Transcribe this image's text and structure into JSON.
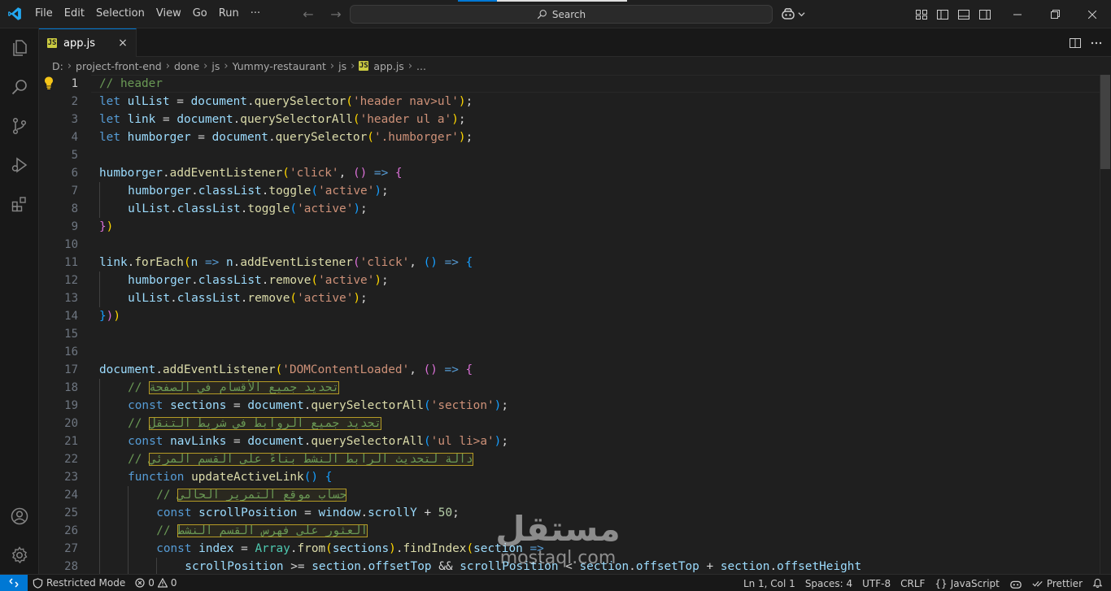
{
  "menu": [
    "File",
    "Edit",
    "Selection",
    "View",
    "Go",
    "Run",
    "···"
  ],
  "search": {
    "label": "Search"
  },
  "tab": {
    "label": "app.js",
    "icon": "JS",
    "close": "×"
  },
  "breadcrumb": [
    {
      "label": "D:"
    },
    {
      "label": "project-front-end"
    },
    {
      "label": "done"
    },
    {
      "label": "js"
    },
    {
      "label": "Yummy-restaurant"
    },
    {
      "label": "js"
    },
    {
      "label": "app.js",
      "file": true
    },
    {
      "label": "..."
    }
  ],
  "editor": {
    "active_line": 1,
    "lines": [
      {
        "n": 1,
        "indent": 0,
        "tokens": [
          {
            "t": "// header",
            "c": "cm"
          }
        ]
      },
      {
        "n": 2,
        "indent": 0,
        "tokens": [
          {
            "t": "let ",
            "c": "kw"
          },
          {
            "t": "ulList",
            "c": "var"
          },
          {
            "t": " = ",
            "c": "pl"
          },
          {
            "t": "document",
            "c": "var"
          },
          {
            "t": ".",
            "c": "pl"
          },
          {
            "t": "querySelector",
            "c": "fn"
          },
          {
            "t": "(",
            "c": "b1"
          },
          {
            "t": "'header nav>ul'",
            "c": "str"
          },
          {
            "t": ")",
            "c": "b1"
          },
          {
            "t": ";",
            "c": "pl"
          }
        ]
      },
      {
        "n": 3,
        "indent": 0,
        "tokens": [
          {
            "t": "let ",
            "c": "kw"
          },
          {
            "t": "link",
            "c": "var"
          },
          {
            "t": " = ",
            "c": "pl"
          },
          {
            "t": "document",
            "c": "var"
          },
          {
            "t": ".",
            "c": "pl"
          },
          {
            "t": "querySelectorAll",
            "c": "fn"
          },
          {
            "t": "(",
            "c": "b1"
          },
          {
            "t": "'header ul a'",
            "c": "str"
          },
          {
            "t": ")",
            "c": "b1"
          },
          {
            "t": ";",
            "c": "pl"
          }
        ]
      },
      {
        "n": 4,
        "indent": 0,
        "tokens": [
          {
            "t": "let ",
            "c": "kw"
          },
          {
            "t": "humborger",
            "c": "var"
          },
          {
            "t": " = ",
            "c": "pl"
          },
          {
            "t": "document",
            "c": "var"
          },
          {
            "t": ".",
            "c": "pl"
          },
          {
            "t": "querySelector",
            "c": "fn"
          },
          {
            "t": "(",
            "c": "b1"
          },
          {
            "t": "'.humborger'",
            "c": "str"
          },
          {
            "t": ")",
            "c": "b1"
          },
          {
            "t": ";",
            "c": "pl"
          }
        ]
      },
      {
        "n": 5,
        "indent": 0,
        "tokens": []
      },
      {
        "n": 6,
        "indent": 0,
        "tokens": [
          {
            "t": "humborger",
            "c": "var"
          },
          {
            "t": ".",
            "c": "pl"
          },
          {
            "t": "addEventListener",
            "c": "fn"
          },
          {
            "t": "(",
            "c": "b1"
          },
          {
            "t": "'click'",
            "c": "str"
          },
          {
            "t": ", ",
            "c": "pl"
          },
          {
            "t": "()",
            "c": "b2"
          },
          {
            "t": " => ",
            "c": "kw"
          },
          {
            "t": "{",
            "c": "b2"
          }
        ]
      },
      {
        "n": 7,
        "indent": 1,
        "tokens": [
          {
            "t": "humborger",
            "c": "var"
          },
          {
            "t": ".",
            "c": "pl"
          },
          {
            "t": "classList",
            "c": "var"
          },
          {
            "t": ".",
            "c": "pl"
          },
          {
            "t": "toggle",
            "c": "fn"
          },
          {
            "t": "(",
            "c": "b3"
          },
          {
            "t": "'active'",
            "c": "str"
          },
          {
            "t": ")",
            "c": "b3"
          },
          {
            "t": ";",
            "c": "pl"
          }
        ]
      },
      {
        "n": 8,
        "indent": 1,
        "tokens": [
          {
            "t": "ulList",
            "c": "var"
          },
          {
            "t": ".",
            "c": "pl"
          },
          {
            "t": "classList",
            "c": "var"
          },
          {
            "t": ".",
            "c": "pl"
          },
          {
            "t": "toggle",
            "c": "fn"
          },
          {
            "t": "(",
            "c": "b3"
          },
          {
            "t": "'active'",
            "c": "str"
          },
          {
            "t": ")",
            "c": "b3"
          },
          {
            "t": ";",
            "c": "pl"
          }
        ]
      },
      {
        "n": 9,
        "indent": 0,
        "tokens": [
          {
            "t": "}",
            "c": "b2"
          },
          {
            "t": ")",
            "c": "b1"
          }
        ]
      },
      {
        "n": 10,
        "indent": 0,
        "tokens": []
      },
      {
        "n": 11,
        "indent": 0,
        "tokens": [
          {
            "t": "link",
            "c": "var"
          },
          {
            "t": ".",
            "c": "pl"
          },
          {
            "t": "forEach",
            "c": "fn"
          },
          {
            "t": "(",
            "c": "b1"
          },
          {
            "t": "n",
            "c": "var"
          },
          {
            "t": " => ",
            "c": "kw"
          },
          {
            "t": "n",
            "c": "var"
          },
          {
            "t": ".",
            "c": "pl"
          },
          {
            "t": "addEventListener",
            "c": "fn"
          },
          {
            "t": "(",
            "c": "b2"
          },
          {
            "t": "'click'",
            "c": "str"
          },
          {
            "t": ", ",
            "c": "pl"
          },
          {
            "t": "()",
            "c": "b3"
          },
          {
            "t": " => ",
            "c": "kw"
          },
          {
            "t": "{",
            "c": "b3"
          }
        ]
      },
      {
        "n": 12,
        "indent": 1,
        "tokens": [
          {
            "t": "humborger",
            "c": "var"
          },
          {
            "t": ".",
            "c": "pl"
          },
          {
            "t": "classList",
            "c": "var"
          },
          {
            "t": ".",
            "c": "pl"
          },
          {
            "t": "remove",
            "c": "fn"
          },
          {
            "t": "(",
            "c": "b1"
          },
          {
            "t": "'active'",
            "c": "str"
          },
          {
            "t": ")",
            "c": "b1"
          },
          {
            "t": ";",
            "c": "pl"
          }
        ]
      },
      {
        "n": 13,
        "indent": 1,
        "tokens": [
          {
            "t": "ulList",
            "c": "var"
          },
          {
            "t": ".",
            "c": "pl"
          },
          {
            "t": "classList",
            "c": "var"
          },
          {
            "t": ".",
            "c": "pl"
          },
          {
            "t": "remove",
            "c": "fn"
          },
          {
            "t": "(",
            "c": "b1"
          },
          {
            "t": "'active'",
            "c": "str"
          },
          {
            "t": ")",
            "c": "b1"
          },
          {
            "t": ";",
            "c": "pl"
          }
        ]
      },
      {
        "n": 14,
        "indent": 0,
        "tokens": [
          {
            "t": "}",
            "c": "b3"
          },
          {
            "t": ")",
            "c": "b2"
          },
          {
            "t": ")",
            "c": "b1"
          }
        ]
      },
      {
        "n": 15,
        "indent": 0,
        "tokens": []
      },
      {
        "n": 16,
        "indent": 0,
        "tokens": []
      },
      {
        "n": 17,
        "indent": 0,
        "tokens": [
          {
            "t": "document",
            "c": "var"
          },
          {
            "t": ".",
            "c": "pl"
          },
          {
            "t": "addEventListener",
            "c": "fn"
          },
          {
            "t": "(",
            "c": "b1"
          },
          {
            "t": "'DOMContentLoaded'",
            "c": "str"
          },
          {
            "t": ", ",
            "c": "pl"
          },
          {
            "t": "()",
            "c": "b2"
          },
          {
            "t": " => ",
            "c": "kw"
          },
          {
            "t": "{",
            "c": "b2"
          }
        ]
      },
      {
        "n": 18,
        "indent": 1,
        "tokens": [
          {
            "t": "// ",
            "c": "cm"
          },
          {
            "t": "تحديد جميع الأقسام في الصفحة",
            "c": "cm",
            "hl": true
          }
        ]
      },
      {
        "n": 19,
        "indent": 1,
        "tokens": [
          {
            "t": "const ",
            "c": "kw"
          },
          {
            "t": "sections",
            "c": "var"
          },
          {
            "t": " = ",
            "c": "pl"
          },
          {
            "t": "document",
            "c": "var"
          },
          {
            "t": ".",
            "c": "pl"
          },
          {
            "t": "querySelectorAll",
            "c": "fn"
          },
          {
            "t": "(",
            "c": "b3"
          },
          {
            "t": "'section'",
            "c": "str"
          },
          {
            "t": ")",
            "c": "b3"
          },
          {
            "t": ";",
            "c": "pl"
          }
        ]
      },
      {
        "n": 20,
        "indent": 1,
        "tokens": [
          {
            "t": "// ",
            "c": "cm"
          },
          {
            "t": "تحديد جميع الروابط في شريط التنقل",
            "c": "cm",
            "hl": true
          }
        ]
      },
      {
        "n": 21,
        "indent": 1,
        "tokens": [
          {
            "t": "const ",
            "c": "kw"
          },
          {
            "t": "navLinks",
            "c": "var"
          },
          {
            "t": " = ",
            "c": "pl"
          },
          {
            "t": "document",
            "c": "var"
          },
          {
            "t": ".",
            "c": "pl"
          },
          {
            "t": "querySelectorAll",
            "c": "fn"
          },
          {
            "t": "(",
            "c": "b3"
          },
          {
            "t": "'ul li>a'",
            "c": "str"
          },
          {
            "t": ")",
            "c": "b3"
          },
          {
            "t": ";",
            "c": "pl"
          }
        ]
      },
      {
        "n": 22,
        "indent": 1,
        "tokens": [
          {
            "t": "// ",
            "c": "cm"
          },
          {
            "t": "دالة لتحديث الرابط النشط بناءً على القسم المرئي",
            "c": "cm",
            "hl": true
          }
        ]
      },
      {
        "n": 23,
        "indent": 1,
        "tokens": [
          {
            "t": "function ",
            "c": "kw"
          },
          {
            "t": "updateActiveLink",
            "c": "fn"
          },
          {
            "t": "()",
            "c": "b3"
          },
          {
            "t": " ",
            "c": "pl"
          },
          {
            "t": "{",
            "c": "b3"
          }
        ]
      },
      {
        "n": 24,
        "indent": 2,
        "tokens": [
          {
            "t": "// ",
            "c": "cm"
          },
          {
            "t": "حساب موقع التمرير الحالي",
            "c": "cm",
            "hl": true
          }
        ]
      },
      {
        "n": 25,
        "indent": 2,
        "tokens": [
          {
            "t": "const ",
            "c": "kw"
          },
          {
            "t": "scrollPosition",
            "c": "var"
          },
          {
            "t": " = ",
            "c": "pl"
          },
          {
            "t": "window",
            "c": "var"
          },
          {
            "t": ".",
            "c": "pl"
          },
          {
            "t": "scrollY",
            "c": "var"
          },
          {
            "t": " + ",
            "c": "pl"
          },
          {
            "t": "50",
            "c": "num"
          },
          {
            "t": ";",
            "c": "pl"
          }
        ]
      },
      {
        "n": 26,
        "indent": 2,
        "tokens": [
          {
            "t": "// ",
            "c": "cm"
          },
          {
            "t": "العثور على فهرس القسم النشط",
            "c": "cm",
            "hl": true
          }
        ]
      },
      {
        "n": 27,
        "indent": 2,
        "tokens": [
          {
            "t": "const ",
            "c": "kw"
          },
          {
            "t": "index",
            "c": "var"
          },
          {
            "t": " = ",
            "c": "pl"
          },
          {
            "t": "Array",
            "c": "cls"
          },
          {
            "t": ".",
            "c": "pl"
          },
          {
            "t": "from",
            "c": "fn"
          },
          {
            "t": "(",
            "c": "b1"
          },
          {
            "t": "sections",
            "c": "var"
          },
          {
            "t": ")",
            "c": "b1"
          },
          {
            "t": ".",
            "c": "pl"
          },
          {
            "t": "findIndex",
            "c": "fn"
          },
          {
            "t": "(",
            "c": "b1"
          },
          {
            "t": "section",
            "c": "var"
          },
          {
            "t": " =>",
            "c": "kw"
          }
        ]
      },
      {
        "n": 28,
        "indent": 3,
        "tokens": [
          {
            "t": "scrollPosition",
            "c": "var"
          },
          {
            "t": " >= ",
            "c": "pl"
          },
          {
            "t": "section",
            "c": "var"
          },
          {
            "t": ".",
            "c": "pl"
          },
          {
            "t": "offsetTop",
            "c": "var"
          },
          {
            "t": " && ",
            "c": "pl"
          },
          {
            "t": "scrollPosition",
            "c": "var"
          },
          {
            "t": " < ",
            "c": "pl"
          },
          {
            "t": "section",
            "c": "var"
          },
          {
            "t": ".",
            "c": "pl"
          },
          {
            "t": "offsetTop",
            "c": "var"
          },
          {
            "t": " + ",
            "c": "pl"
          },
          {
            "t": "section",
            "c": "var"
          },
          {
            "t": ".",
            "c": "pl"
          },
          {
            "t": "offsetHeight",
            "c": "var"
          }
        ]
      }
    ]
  },
  "watermark": {
    "arabic": "مستقل",
    "latin": "mostaql.com"
  },
  "status": {
    "restricted": "Restricted Mode",
    "errors": "0",
    "warnings": "0",
    "position": "Ln 1, Col 1",
    "spaces": "Spaces: 4",
    "encoding": "UTF-8",
    "eol": "CRLF",
    "language_braces": "{}",
    "language": "JavaScript",
    "prettier": "Prettier"
  },
  "colors": {
    "accent": "#0078d4",
    "keyword": "#569cd6",
    "variable": "#9cdcfe",
    "function": "#dcdcaa",
    "string": "#ce9178",
    "comment": "#6a9955"
  }
}
